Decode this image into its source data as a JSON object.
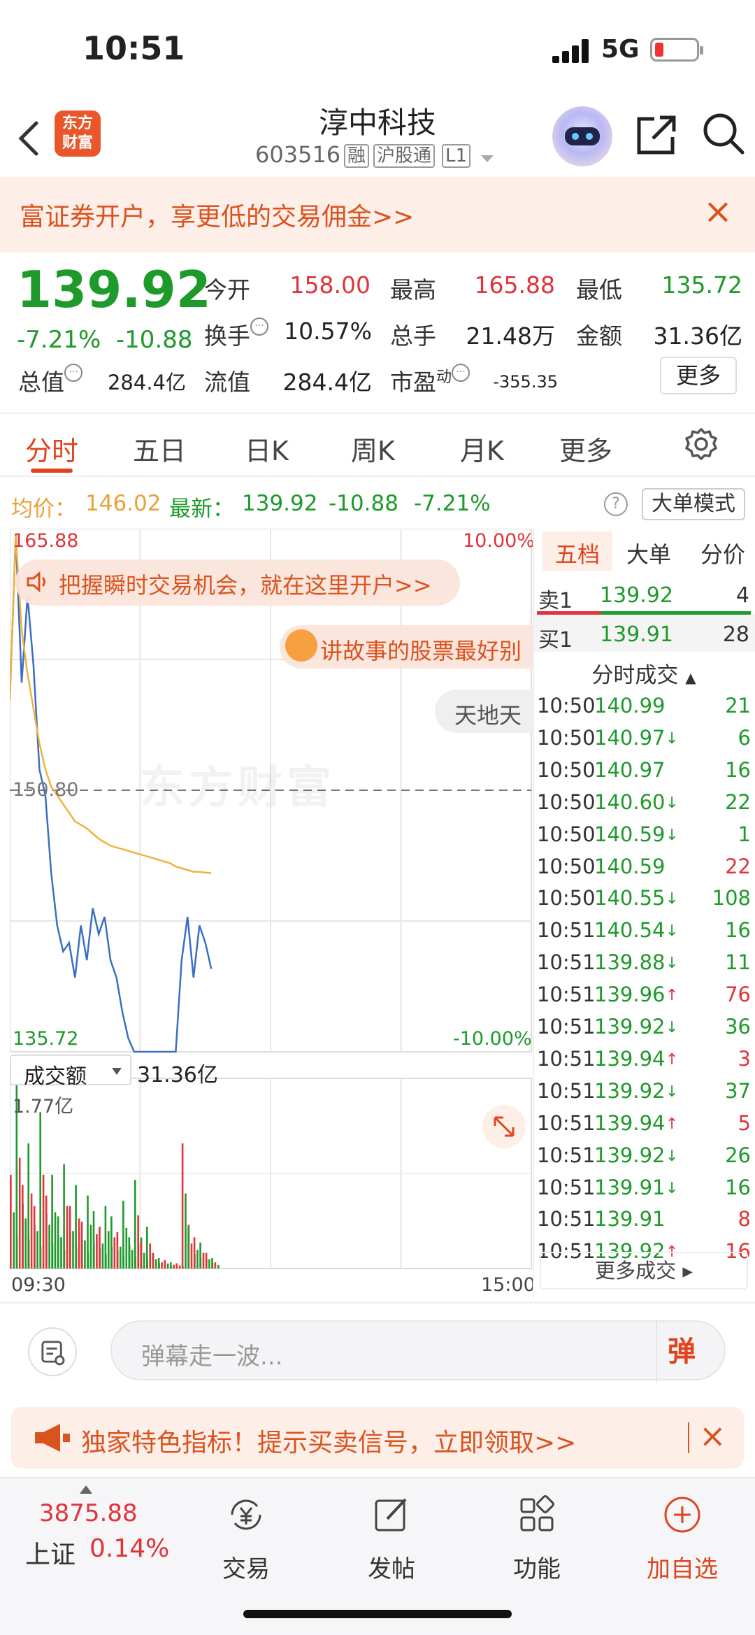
{
  "status": {
    "time": "10:51",
    "network": "5G"
  },
  "header": {
    "logo_line1": "东方",
    "logo_line2": "财富",
    "title": "淳中科技",
    "code": "603516",
    "tags": [
      "融",
      "沪股通",
      "L1"
    ]
  },
  "promo": {
    "text": "富证券开户，享更低的交易佣金>>",
    "close": "×"
  },
  "quote": {
    "price": "139.92",
    "change_pct": "-7.21%",
    "change_amt": "-10.88",
    "labels": {
      "open": "今开",
      "high": "最高",
      "low": "最低",
      "turnover": "换手",
      "volume": "总手",
      "amount": "金额",
      "mktcap": "总值",
      "float_cap": "流值",
      "pe": "市盈",
      "pe_sup": "动"
    },
    "values": {
      "open": "158.00",
      "high": "165.88",
      "low": "135.72",
      "turnover": "10.57%",
      "volume": "21.48万",
      "amount": "31.36亿",
      "mktcap": "284.4亿",
      "float_cap": "284.4亿",
      "pe": "-355.35"
    },
    "more": "更多"
  },
  "tabs": [
    "分时",
    "五日",
    "日K",
    "周K",
    "月K",
    "更多"
  ],
  "avg_info": {
    "avg_label": "均价：",
    "avg_value": "146.02",
    "latest_label": "最新：",
    "latest": "139.92",
    "chg": "-10.88",
    "pct": "-7.21%",
    "help": "?",
    "big_mode": "大单模式"
  },
  "chart": {
    "high": "165.88",
    "low": "135.72",
    "ref": "150.80",
    "pct_up": "10.00%",
    "pct_down": "-10.00%",
    "banner1": "把握瞬时交易机会，就在这里开户>>",
    "banner2": "讲故事的股票最好别",
    "banner3": "天地天",
    "watermark": "东方财富",
    "vol_selector": "成交额",
    "vol_total": "31.36亿",
    "vol_max": "1.77亿",
    "time_start": "09:30",
    "time_end": "15:00"
  },
  "chart_data": {
    "type": "line",
    "title": "",
    "ylim": [
      135.72,
      165.88
    ],
    "reference": 150.8,
    "series": [
      {
        "values": [
          156,
          165.5,
          157,
          162,
          158,
          152,
          150.5,
          146,
          143,
          141.5,
          142,
          140,
          143,
          141,
          144,
          142.5,
          143.5,
          141,
          140,
          138,
          136.5,
          135.72,
          135.72,
          135.72,
          135.72,
          135.72,
          135.72,
          135.72,
          135.72,
          141,
          143.5,
          140,
          143,
          142,
          140.5
        ]
      },
      {
        "values": [
          156,
          165.5,
          160,
          157.5,
          155.5,
          153.5,
          152,
          151,
          150.5,
          150,
          149.5,
          149,
          148.8,
          148.6,
          148.3,
          148,
          147.8,
          147.6,
          147.5,
          147.4,
          147.3,
          147.2,
          147.1,
          147,
          146.9,
          146.8,
          146.7,
          146.6,
          146.4,
          146.3,
          146.2,
          146.1,
          146.1,
          146.05,
          146.02
        ]
      }
    ],
    "volume": {
      "max_label": "1.77亿",
      "values": [
        0.9,
        1.77,
        0.8,
        1.2,
        0.6,
        1.5,
        0.7,
        0.9,
        0.5,
        1.0,
        0.6,
        0.8,
        0.45,
        0.7,
        0.55,
        0.4,
        0.6,
        0.5,
        0.35,
        0.65,
        0.3,
        0.85,
        0.25,
        0.4,
        0.15,
        0.1,
        0.08,
        0.06,
        0.05,
        1.2,
        0.4,
        0.3,
        0.25,
        0.15,
        0.1
      ],
      "colors": [
        "r",
        "g",
        "r",
        "g",
        "r",
        "g",
        "r",
        "g",
        "g",
        "g",
        "r",
        "g",
        "r",
        "g",
        "g",
        "r",
        "g",
        "g",
        "r",
        "g",
        "g",
        "g",
        "r",
        "g",
        "r",
        "g",
        "r",
        "g",
        "r",
        "r",
        "g",
        "r",
        "g",
        "r",
        "g"
      ]
    }
  },
  "book": {
    "tabs": [
      "五档",
      "大单",
      "分价"
    ],
    "sell": {
      "label": "卖1",
      "price": "139.92",
      "vol": "4"
    },
    "buy": {
      "label": "买1",
      "price": "139.91",
      "vol": "28"
    },
    "trades_title": "分时成交",
    "trades": [
      {
        "t": "10:50",
        "p": "140.99",
        "a": "",
        "v": "21",
        "c": "g"
      },
      {
        "t": "10:50",
        "p": "140.97",
        "a": "↓",
        "v": "6",
        "c": "g"
      },
      {
        "t": "10:50",
        "p": "140.97",
        "a": "",
        "v": "16",
        "c": "g"
      },
      {
        "t": "10:50",
        "p": "140.60",
        "a": "↓",
        "v": "22",
        "c": "g"
      },
      {
        "t": "10:50",
        "p": "140.59",
        "a": "↓",
        "v": "1",
        "c": "g"
      },
      {
        "t": "10:50",
        "p": "140.59",
        "a": "",
        "v": "22",
        "c": "r"
      },
      {
        "t": "10:50",
        "p": "140.55",
        "a": "↓",
        "v": "108",
        "c": "g"
      },
      {
        "t": "10:51",
        "p": "140.54",
        "a": "↓",
        "v": "16",
        "c": "g"
      },
      {
        "t": "10:51",
        "p": "139.88",
        "a": "↓",
        "v": "11",
        "c": "g"
      },
      {
        "t": "10:51",
        "p": "139.96",
        "a": "↑",
        "v": "76",
        "c": "r"
      },
      {
        "t": "10:51",
        "p": "139.92",
        "a": "↓",
        "v": "36",
        "c": "g"
      },
      {
        "t": "10:51",
        "p": "139.94",
        "a": "↑",
        "v": "3",
        "c": "r"
      },
      {
        "t": "10:51",
        "p": "139.92",
        "a": "↓",
        "v": "37",
        "c": "g"
      },
      {
        "t": "10:51",
        "p": "139.94",
        "a": "↑",
        "v": "5",
        "c": "r"
      },
      {
        "t": "10:51",
        "p": "139.92",
        "a": "↓",
        "v": "26",
        "c": "g"
      },
      {
        "t": "10:51",
        "p": "139.91",
        "a": "↓",
        "v": "16",
        "c": "g"
      },
      {
        "t": "10:51",
        "p": "139.91",
        "a": "",
        "v": "8",
        "c": "r"
      },
      {
        "t": "10:51",
        "p": "139.92",
        "a": "↑",
        "v": "16",
        "c": "r"
      }
    ],
    "more_trades": "更多成交 ▸"
  },
  "comment": {
    "placeholder": "弹幕走一波...",
    "dan": "弹"
  },
  "signal_promo": {
    "text": "独家特色指标！提示买卖信号，立即领取>>",
    "close": "×"
  },
  "bottom": {
    "index_value": "3875.88",
    "index_name": "上证",
    "index_pct": "0.14%",
    "nav": [
      "交易",
      "发帖",
      "功能",
      "加自选"
    ]
  },
  "colors": {
    "red": "#e0333a",
    "green": "#1e9a2b",
    "orange": "#e0441e",
    "avg_line": "#f0b23c",
    "price_line": "#3a6fc4"
  }
}
